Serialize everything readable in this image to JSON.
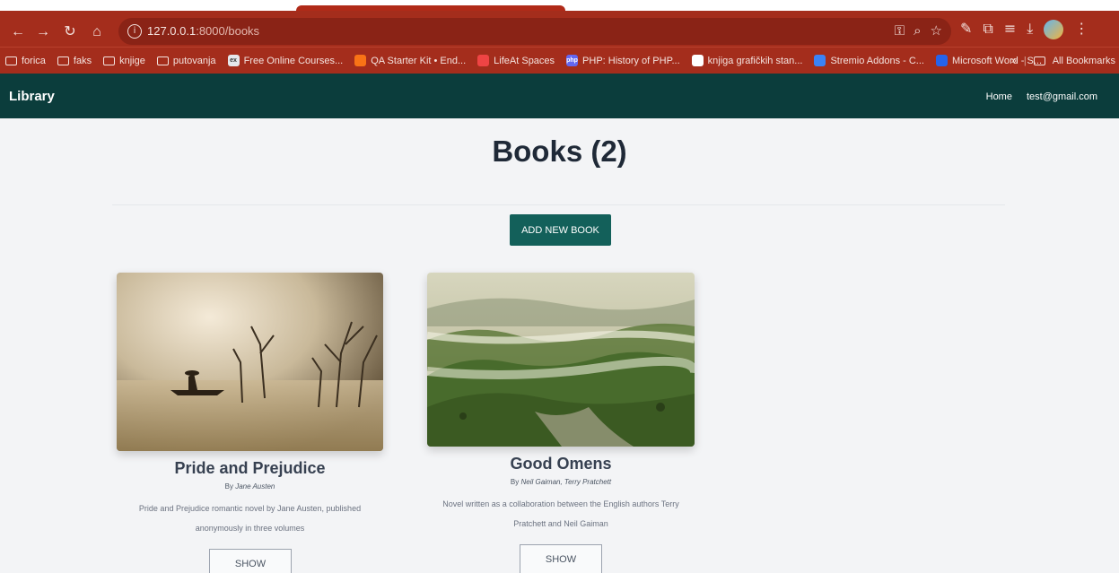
{
  "browser": {
    "url_host": "127.0.0.1",
    "url_path": ":8000/books",
    "bookmarks": [
      {
        "label": "forica",
        "type": "folder"
      },
      {
        "label": "faks",
        "type": "folder"
      },
      {
        "label": "knjige",
        "type": "folder"
      },
      {
        "label": "putovanja",
        "type": "folder"
      },
      {
        "label": "Free Online Courses...",
        "type": "site",
        "color": "#e5e7eb",
        "icon_text": "ex"
      },
      {
        "label": "QA Starter Kit • End...",
        "type": "site",
        "color": "#f97316",
        "icon_text": ""
      },
      {
        "label": "LifeAt Spaces",
        "type": "site",
        "color": "#ef4444",
        "icon_text": ""
      },
      {
        "label": "PHP: History of PHP...",
        "type": "site",
        "color": "#6366f1",
        "icon_text": "php"
      },
      {
        "label": "knjiga grafičkih stan...",
        "type": "site",
        "color": "#ffffff",
        "icon_text": ""
      },
      {
        "label": "Stremio Addons - C...",
        "type": "site",
        "color": "#3b82f6",
        "icon_text": ""
      },
      {
        "label": "Microsoft Word - S...",
        "type": "site",
        "color": "#2563eb",
        "icon_text": ""
      }
    ],
    "overflow": "»",
    "all_bookmarks": "All Bookmarks"
  },
  "app": {
    "brand": "Library",
    "nav": {
      "home": "Home",
      "user": "test@gmail.com"
    }
  },
  "main": {
    "title": "Books (2)",
    "add_button": "ADD NEW BOOK",
    "books": [
      {
        "title": "Pride and Prejudice",
        "by": "By",
        "author": "Jane Austen",
        "description": "Pride and Prejudice romantic novel by Jane Austen, published anonymously in three volumes",
        "button": "SHOW"
      },
      {
        "title": "Good Omens",
        "by": "By",
        "author": "Neil Gaiman, Terry Pratchett",
        "description": "Novel written as a collaboration between the English authors Terry Pratchett and Neil Gaiman",
        "button": "SHOW"
      }
    ]
  }
}
